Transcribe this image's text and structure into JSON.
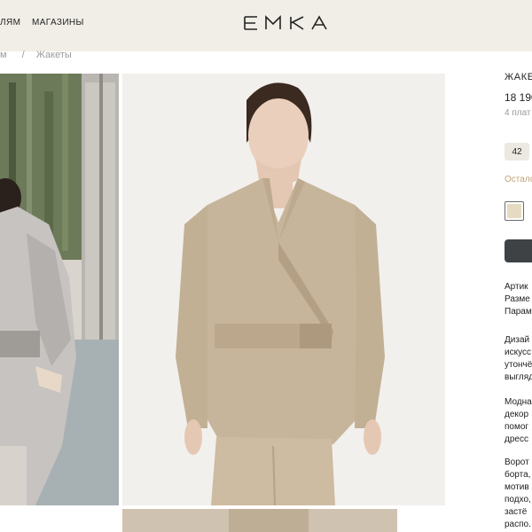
{
  "header": {
    "nav": [
      "ЛЯМ",
      "МАГАЗИНЫ"
    ],
    "logo_text": "EMKA"
  },
  "breadcrumb": {
    "parent": "м",
    "separator": "/",
    "current": "Жакеты"
  },
  "product": {
    "title": "ЖАКЕ",
    "price": "18 190",
    "installments": "4 плат",
    "size_selected": "42",
    "stock_note": "Остало",
    "color_swatch": "#e6dac2",
    "cart_button_color": "#3f4245",
    "specs": [
      "Артик",
      "Разме",
      "Парам"
    ],
    "description": [
      [
        "Дизай",
        "искусс",
        "утончё",
        "выгляд"
      ],
      [
        "Модна",
        "декор",
        "помог",
        "дресс"
      ],
      [
        "Ворот",
        "борта,",
        "мотив",
        "подхо,",
        "застё",
        "распо."
      ]
    ]
  },
  "colors": {
    "header_bg": "#f1eee7",
    "accent_stock": "#c2a27c",
    "jacket": "#c7b59b"
  }
}
